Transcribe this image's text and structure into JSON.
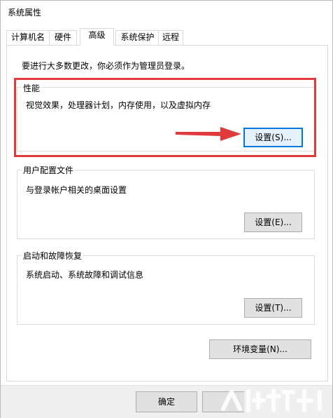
{
  "window": {
    "title": "系统属性"
  },
  "tabs": [
    {
      "label": "计算机名",
      "active": false
    },
    {
      "label": "硬件",
      "active": false
    },
    {
      "label": "高级",
      "active": true
    },
    {
      "label": "系统保护",
      "active": false
    },
    {
      "label": "远程",
      "active": false
    }
  ],
  "notice": "要进行大多数更改，你必须作为管理员登录。",
  "groups": {
    "performance": {
      "title": "性能",
      "description": "视觉效果，处理器计划，内存使用，以及虚拟内存",
      "button": "设置(S)..."
    },
    "user_profiles": {
      "title": "用户配置文件",
      "description": "与登录帐户相关的桌面设置",
      "button": "设置(E)..."
    },
    "startup_recovery": {
      "title": "启动和故障恢复",
      "description": "系统启动、系统故障和调试信息",
      "button": "设置(T)..."
    }
  },
  "env_button": "环境变量(N)...",
  "footer": {
    "ok_button": "确定"
  },
  "colors": {
    "highlight": "#e03a3a",
    "focus": "#0078d7"
  },
  "annotations": {
    "highlight_box": "red-rectangle",
    "arrow": "red-arrow-pointing-right"
  }
}
